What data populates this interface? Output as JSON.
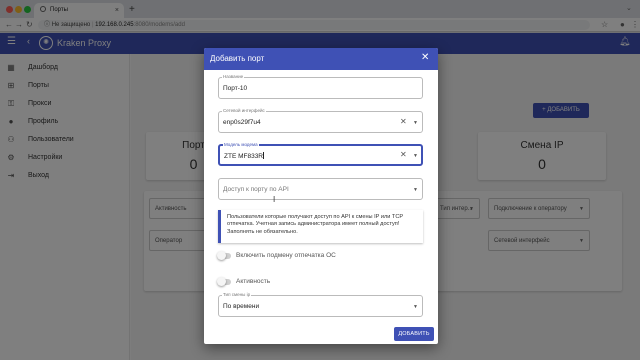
{
  "browser": {
    "tab_title": "Порты",
    "new_tab_symbol": "+",
    "close_symbol": "×",
    "address": {
      "security_label": "Не защищено",
      "host": "192.168.0.245",
      "path": ":8080/modems/add"
    }
  },
  "app": {
    "brand": "Kraken Proxy",
    "accent_color": "#3f51b5"
  },
  "sidebar": {
    "items": [
      {
        "label": "Дашборд",
        "icon": "dashboard-icon"
      },
      {
        "label": "Порты",
        "icon": "network-icon"
      },
      {
        "label": "Прокси",
        "icon": "vpn-icon"
      },
      {
        "label": "Профиль",
        "icon": "person-icon"
      },
      {
        "label": "Пользователи",
        "icon": "people-icon"
      },
      {
        "label": "Настройки",
        "icon": "gear-icon"
      },
      {
        "label": "Выход",
        "icon": "exit-icon"
      }
    ]
  },
  "background": {
    "add_button": "+ ДОБАВИТЬ",
    "cards": [
      {
        "title": "Порт",
        "value": "0"
      },
      {
        "title": "Смена IP",
        "value": "0"
      }
    ],
    "filters": [
      "Активность",
      "Тип интер...",
      "Подключение к оператору",
      "Оператор",
      "Сетевой интерфейс"
    ]
  },
  "dialog": {
    "title": "Добавить порт",
    "fields": {
      "name": {
        "label": "Название",
        "value": "Порт-10"
      },
      "iface": {
        "label": "Сетевой интерфейс",
        "value": "enp0s29f7u4"
      },
      "modem": {
        "label": "Модель модема",
        "value": "ZTE MF833R"
      },
      "api": {
        "placeholder": "Доступ к порту по API"
      },
      "ip_change": {
        "label": "Тип смены ip",
        "value": "По времени"
      }
    },
    "info": "Пользователи которые получают доступ по API к смены IP или TCP отпечатка. Учетная запись администратора имеет полный доступ! Заполнять не обязательно.",
    "toggles": {
      "fingerprint": "Включить подмену отпечатка ОС",
      "active": "Активность"
    },
    "save": "ДОБАВИТЬ"
  }
}
